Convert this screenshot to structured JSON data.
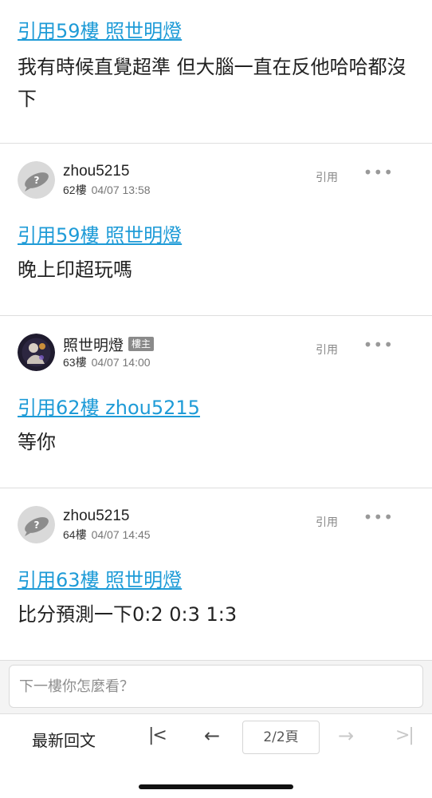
{
  "top_post": {
    "quote": "引用59樓 照世明燈",
    "body": "我有時候直覺超準 但大腦一直在反他哈哈都沒下"
  },
  "posts": [
    {
      "username": "zhou5215",
      "floor": "62樓",
      "time": "04/07 13:58",
      "reply_label": "引用",
      "more_label": "•••",
      "quote": "引用59樓 照世明燈",
      "body": "晚上印超玩嗎"
    },
    {
      "username": "照世明燈",
      "badge": "樓主",
      "floor": "63樓",
      "time": "04/07 14:00",
      "reply_label": "引用",
      "more_label": "•••",
      "quote": "引用62樓 zhou5215",
      "body": "等你"
    },
    {
      "username": "zhou5215",
      "floor": "64樓",
      "time": "04/07 14:45",
      "reply_label": "引用",
      "more_label": "•••",
      "quote": "引用63樓 照世明燈",
      "body": "比分預測一下0:2 0:3 1:3"
    }
  ],
  "comment": {
    "placeholder": "下一樓你怎麼看？"
  },
  "nav": {
    "latest_label": "最新回文",
    "first_icon": "|<",
    "prev_icon": "←",
    "page_label": "2/2頁",
    "next_icon": "→",
    "last_icon": ">|"
  },
  "colors": {
    "link": "#1e9bd7",
    "badge": "#8a8a8a",
    "divider": "#dedede"
  }
}
